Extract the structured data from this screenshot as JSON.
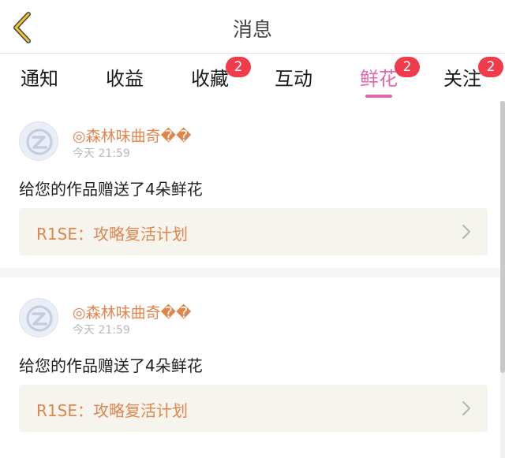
{
  "header": {
    "title": "消息"
  },
  "tabs": [
    {
      "label": "通知",
      "badge": ""
    },
    {
      "label": "收益",
      "badge": ""
    },
    {
      "label": "收藏",
      "badge": "2"
    },
    {
      "label": "互动",
      "badge": ""
    },
    {
      "label": "鲜花",
      "badge": "2",
      "active": true
    },
    {
      "label": "关注",
      "badge": "2"
    }
  ],
  "messages": [
    {
      "username": "◎森林味曲奇��",
      "time": "今天 21:59",
      "text": "给您的作品赠送了4朵鲜花",
      "work_title": "R1SE：攻略复活计划"
    },
    {
      "username": "◎森林味曲奇��",
      "time": "今天 21:59",
      "text": "给您的作品赠送了4朵鲜花",
      "work_title": "R1SE：攻略复活计划"
    }
  ],
  "colors": {
    "accent": "#e06aa8",
    "badge": "#f03c4a",
    "name": "#e0854e",
    "work_bg": "#f5f5ee"
  },
  "icons": {
    "back": "chevron-left-icon",
    "work_link": "chevron-right-icon",
    "avatar": "default-avatar-icon"
  }
}
